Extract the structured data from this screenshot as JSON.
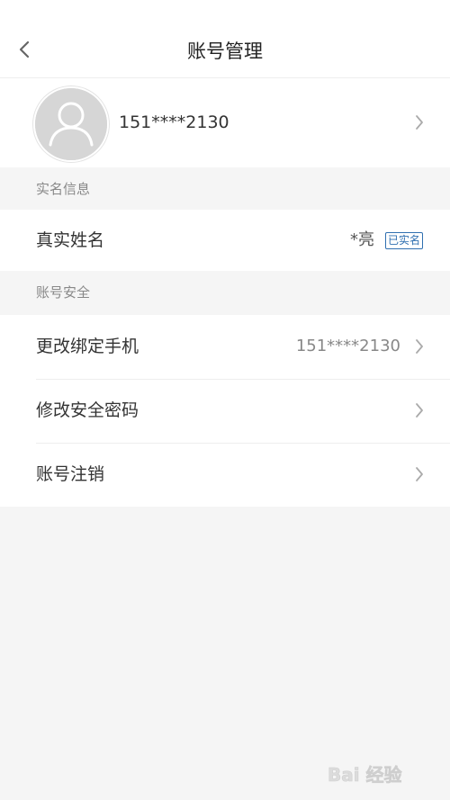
{
  "header": {
    "title": "账号管理",
    "back_icon": "chevron-left-icon"
  },
  "profile": {
    "avatar_icon": "user-avatar-icon",
    "phone": "151****2130",
    "arrow_icon": "chevron-right-icon"
  },
  "realname_section": {
    "title": "实名信息",
    "rows": [
      {
        "label": "真实姓名",
        "value": "*亮",
        "badge": "已实名"
      }
    ]
  },
  "security_section": {
    "title": "账号安全",
    "rows": [
      {
        "label": "更改绑定手机",
        "value": "151****2130"
      },
      {
        "label": "修改安全密码",
        "value": ""
      },
      {
        "label": "账号注销",
        "value": ""
      }
    ]
  },
  "watermark": {
    "text": "Bai 经验"
  },
  "colors": {
    "badge": "#2f6fb0",
    "background": "#f5f5f5",
    "chevron": "#aaaaaa"
  }
}
